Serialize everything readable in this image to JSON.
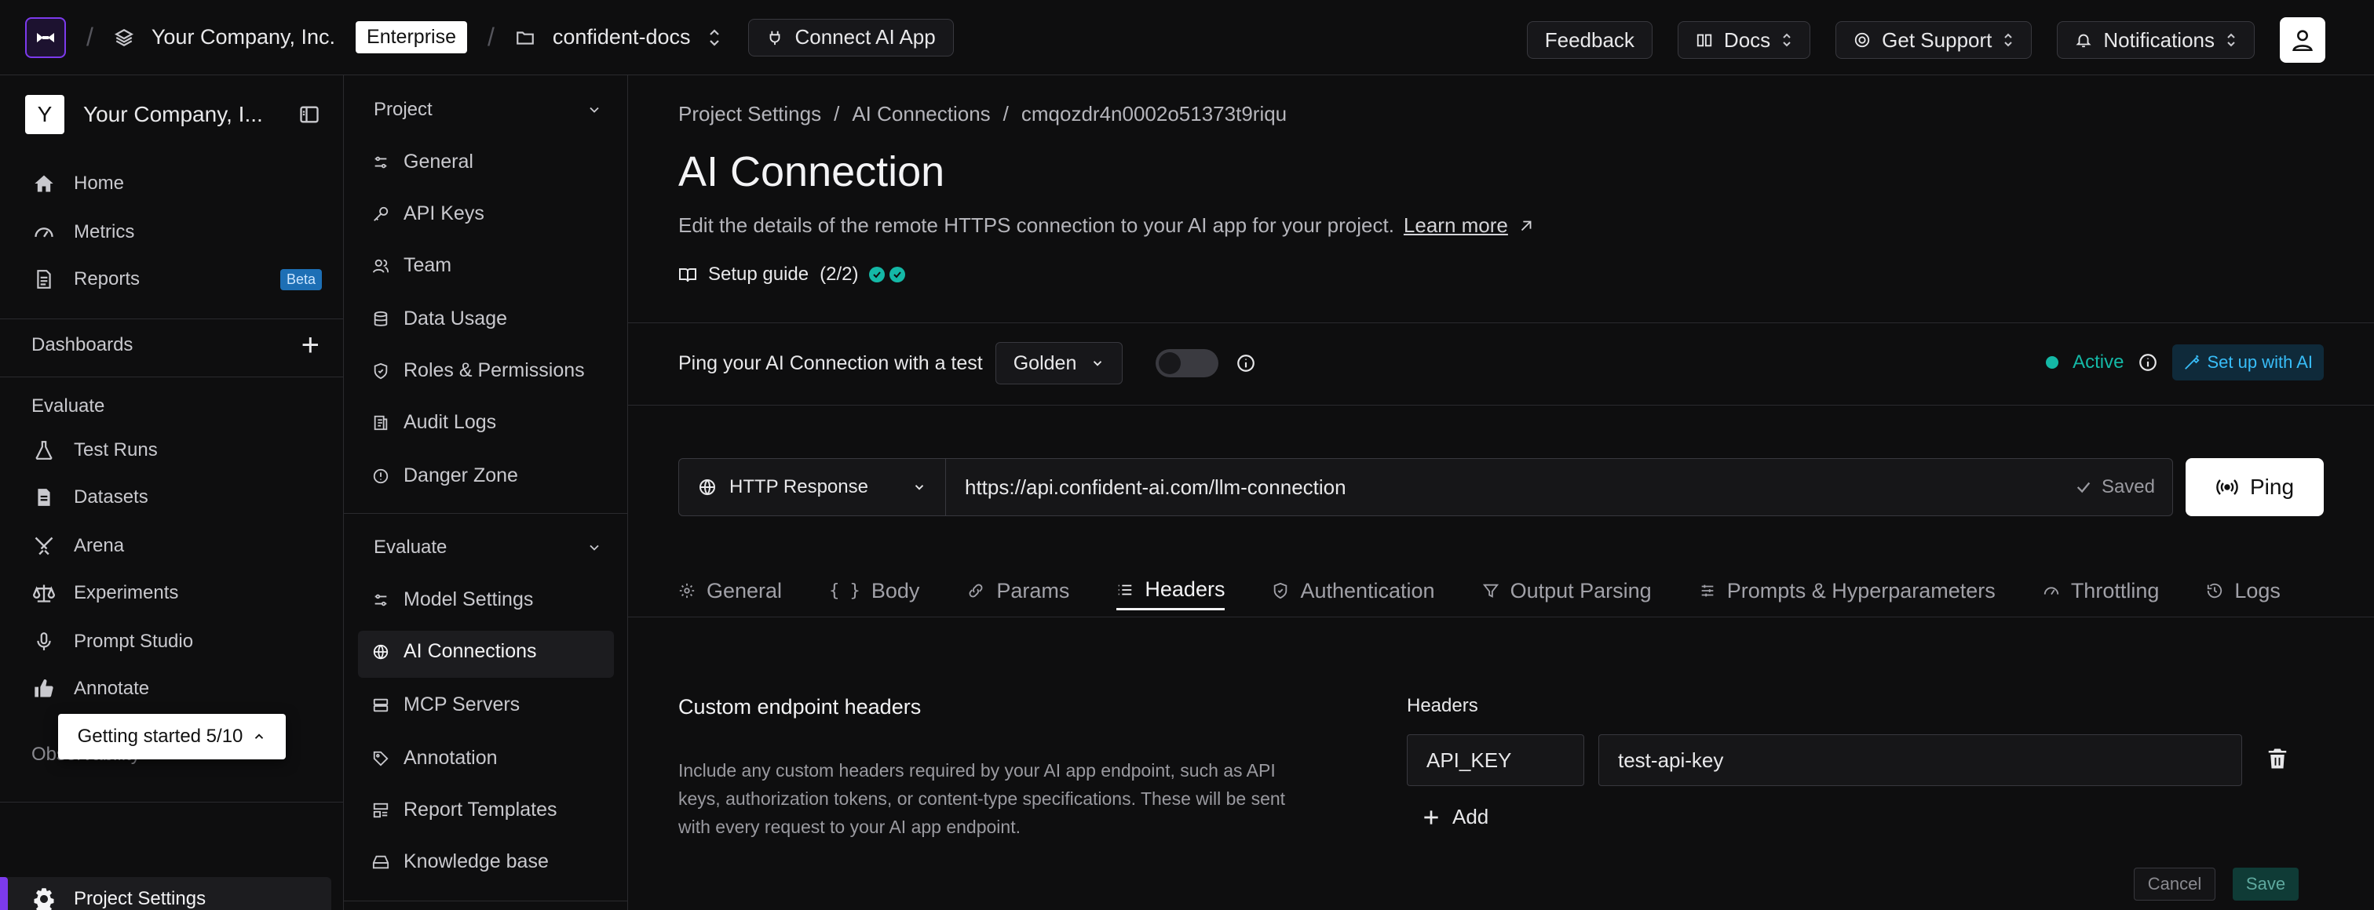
{
  "topbar": {
    "company": "Your Company, Inc.",
    "plan_badge": "Enterprise",
    "project": "confident-docs",
    "connect_ai_app": "Connect AI App",
    "feedback": "Feedback",
    "docs": "Docs",
    "get_support": "Get Support",
    "notifications": "Notifications"
  },
  "sidebar": {
    "org_initial": "Y",
    "org_name": "Your Company, I...",
    "items": [
      {
        "label": "Home",
        "icon": "home-icon"
      },
      {
        "label": "Metrics",
        "icon": "gauge-icon"
      },
      {
        "label": "Reports",
        "icon": "document-icon",
        "badge": "Beta"
      }
    ],
    "dashboards": "Dashboards",
    "evaluate": "Evaluate",
    "evaluate_items": [
      {
        "label": "Test Runs",
        "icon": "flask-icon"
      },
      {
        "label": "Datasets",
        "icon": "file-icon"
      },
      {
        "label": "Arena",
        "icon": "swords-icon"
      },
      {
        "label": "Experiments",
        "icon": "scale-icon"
      },
      {
        "label": "Prompt Studio",
        "icon": "mic-icon"
      },
      {
        "label": "Annotate",
        "icon": "thumbs-icon"
      }
    ],
    "observability_partial": "Observability",
    "getting_started": "Getting started 5/10",
    "project_settings": "Project Settings"
  },
  "settings_nav": {
    "project_heading": "Project",
    "project_items": [
      "General",
      "API Keys",
      "Team",
      "Data Usage",
      "Roles & Permissions",
      "Audit Logs",
      "Danger Zone"
    ],
    "evaluate_heading": "Evaluate",
    "evaluate_items": [
      "Model Settings",
      "AI Connections",
      "MCP Servers",
      "Annotation",
      "Report Templates",
      "Knowledge base"
    ]
  },
  "main": {
    "breadcrumb": [
      "Project Settings",
      "AI Connections",
      "cmqozdr4n0002o51373t9riqu"
    ],
    "title": "AI Connection",
    "description": "Edit the details of the remote HTTPS connection to your AI app for your project.",
    "learn_more": "Learn more",
    "setup_guide": "Setup guide",
    "setup_progress": "(2/2)",
    "ping_label": "Ping your AI Connection with a test",
    "golden_select": "Golden",
    "status": "Active",
    "setup_with_ai": "Set up with AI",
    "method": "HTTP Response",
    "url": "https://api.confident-ai.com/llm-connection",
    "saved": "Saved",
    "ping_button": "Ping",
    "tabs": [
      "General",
      "Body",
      "Params",
      "Headers",
      "Authentication",
      "Output Parsing",
      "Prompts & Hyperparameters",
      "Throttling",
      "Logs"
    ],
    "active_tab": "Headers",
    "custom_headers_title": "Custom endpoint headers",
    "custom_headers_desc": "Include any custom headers required by your AI app endpoint, such as API keys, authorization tokens, or content-type specifications. These will be sent with every request to your AI app endpoint.",
    "headers_label": "Headers",
    "header_key": "API_KEY",
    "header_value": "test-api-key",
    "add": "Add",
    "cancel": "Cancel",
    "save": "Save"
  },
  "colors": {
    "accent": "#7c3aed",
    "teal": "#14b8a6",
    "background": "#0e0e0f"
  }
}
